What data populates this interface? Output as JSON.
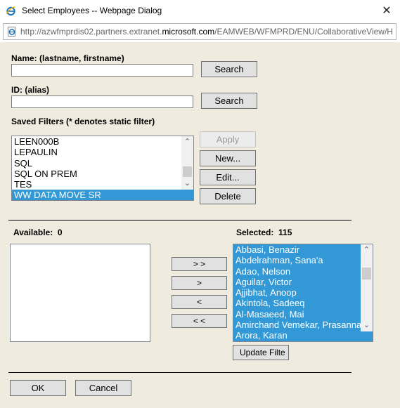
{
  "window": {
    "title": "Select Employees -- Webpage Dialog",
    "close_glyph": "✕",
    "url_prefix": "http://azwfmprdis02.partners.extranet.",
    "url_domain": "microsoft.com",
    "url_suffix": "/EAMWEB/WFMPRD/ENU/CollaborativeView/H"
  },
  "name_search": {
    "label": "Name: (lastname, firstname)",
    "value": "",
    "button": "Search"
  },
  "id_search": {
    "label": "ID: (alias)",
    "value": "",
    "button": "Search"
  },
  "saved_filters": {
    "label": "Saved Filters (* denotes static filter)",
    "items": [
      "LEEN000B",
      "LEPAULIN",
      "SQL",
      "SQL ON PREM",
      "TES",
      "WW DATA MOVE SR"
    ],
    "selected": "WW DATA MOVE SR",
    "buttons": {
      "apply": "Apply",
      "new": "New...",
      "edit": "Edit...",
      "delete": "Delete"
    }
  },
  "available": {
    "label": "Available:",
    "count": "0",
    "items": []
  },
  "selected": {
    "label": "Selected:",
    "count": "115",
    "items": [
      "Abbasi, Benazir",
      "Abdelrahman, Sana'a",
      "Adao, Nelson",
      "Aguilar, Victor",
      "Ajjibhat, Anoop",
      "Akintola, Sadeeq",
      "Al-Masaeed, Mai",
      "Amirchand Vemekar, Prasanna",
      "Arora, Karan"
    ],
    "update_button": "Update Filte"
  },
  "move_buttons": {
    "add_all": "> >",
    "add": ">",
    "remove": "<",
    "remove_all": "< <"
  },
  "footer": {
    "ok": "OK",
    "cancel": "Cancel"
  },
  "colors": {
    "dialog_bg": "#efebde",
    "selection": "#3399d6"
  },
  "icons": {
    "app": "ie-icon",
    "address": "ie-page-icon",
    "close": "close-icon"
  }
}
